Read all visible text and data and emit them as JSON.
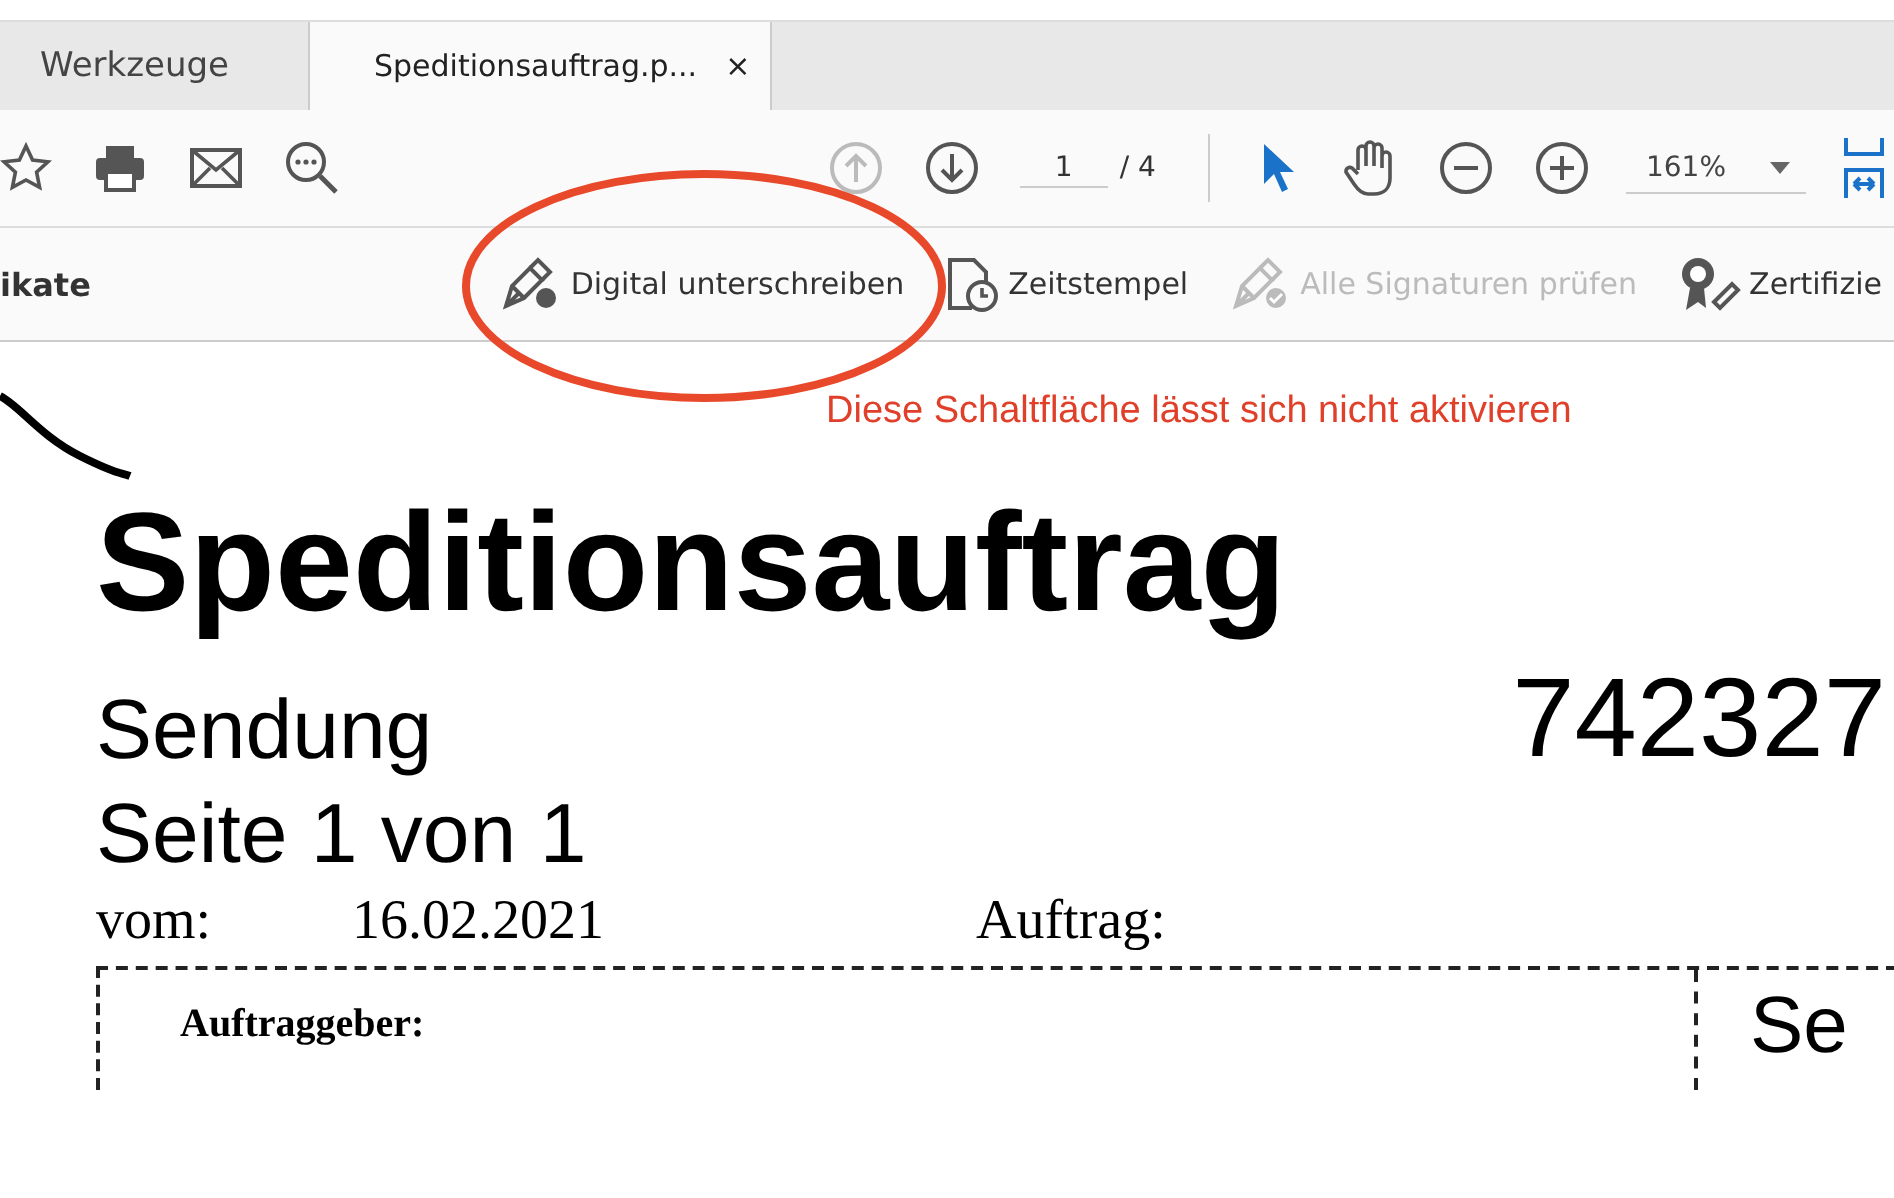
{
  "tabs": [
    {
      "label": "Werkzeuge",
      "selected": false
    },
    {
      "label": "Speditionsauftrag.p...",
      "selected": true,
      "close": "×"
    }
  ],
  "toolbar": {
    "tools": [
      {
        "kind": "star"
      },
      {
        "kind": "print"
      },
      {
        "kind": "mail"
      },
      {
        "kind": "find"
      }
    ],
    "nav": [
      {
        "kind": "up",
        "disabled": true
      },
      {
        "kind": "down",
        "disabled": false
      }
    ],
    "page": {
      "value": "1",
      "total": "/ 4"
    },
    "modes": [
      {
        "kind": "pointer",
        "selected": true
      },
      {
        "kind": "hand",
        "selected": false
      },
      {
        "kind": "zoom-out",
        "selected": false
      },
      {
        "kind": "zoom-in",
        "selected": false
      }
    ],
    "zoom": {
      "value": "161%"
    }
  },
  "sign_bar": {
    "title": "ikate",
    "actions": [
      {
        "label": "Digital unterschreiben",
        "kind": "sign",
        "disabled": false
      },
      {
        "label": "Zeitstempel",
        "kind": "timestamp",
        "disabled": false
      },
      {
        "label": "Alle Signaturen prüfen",
        "kind": "verify",
        "disabled": true
      },
      {
        "label": "Zertifizie",
        "kind": "certify",
        "disabled": false
      }
    ]
  },
  "annotation": {
    "text": "Diese Schaltfläche lässt sich nicht aktivieren"
  },
  "document": {
    "title": "Speditionsauftrag",
    "subtitle": "Sendung",
    "number": "742327",
    "page_info": "Seite 1 von 1",
    "date_label": "vom:",
    "date": "16.02.2021",
    "order_label": "Auftrag:",
    "client_label": "Auftraggeber:",
    "right_cell": "Se"
  }
}
